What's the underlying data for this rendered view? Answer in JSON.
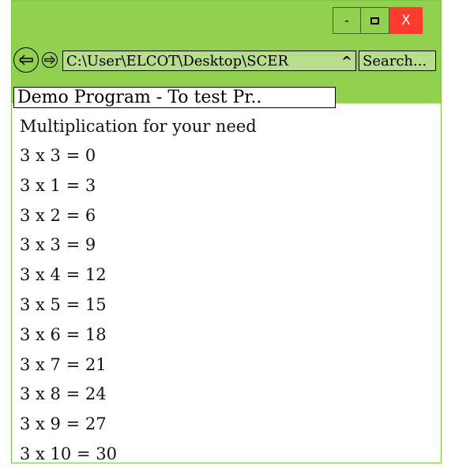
{
  "window": {
    "minimize_label": "-",
    "close_label": "X"
  },
  "nav": {
    "back_icon": "back-arrow-icon",
    "forward_icon": "forward-arrow-icon",
    "address": "C:\\User\\ELCOT\\Desktop\\SCER",
    "address_caret": "^",
    "search_placeholder": "Search..."
  },
  "tab": {
    "title": "Demo Program - To test Pr.."
  },
  "page": {
    "heading": "Multiplication for your need",
    "lines": [
      "3 x 3 = 0",
      "3 x 1 = 3",
      "3 x 2 = 6",
      "3 x 3 = 9",
      "3 x 4 = 12",
      "3 x 5 = 15",
      "3 x 6 = 18",
      "3 x 7 = 21",
      "3 x 8 = 24",
      "3 x 9 = 27",
      "3 x 10 = 30"
    ]
  },
  "colors": {
    "chrome": "#92d050",
    "address_bg": "#b7dd8d",
    "close": "#ff3b30"
  }
}
